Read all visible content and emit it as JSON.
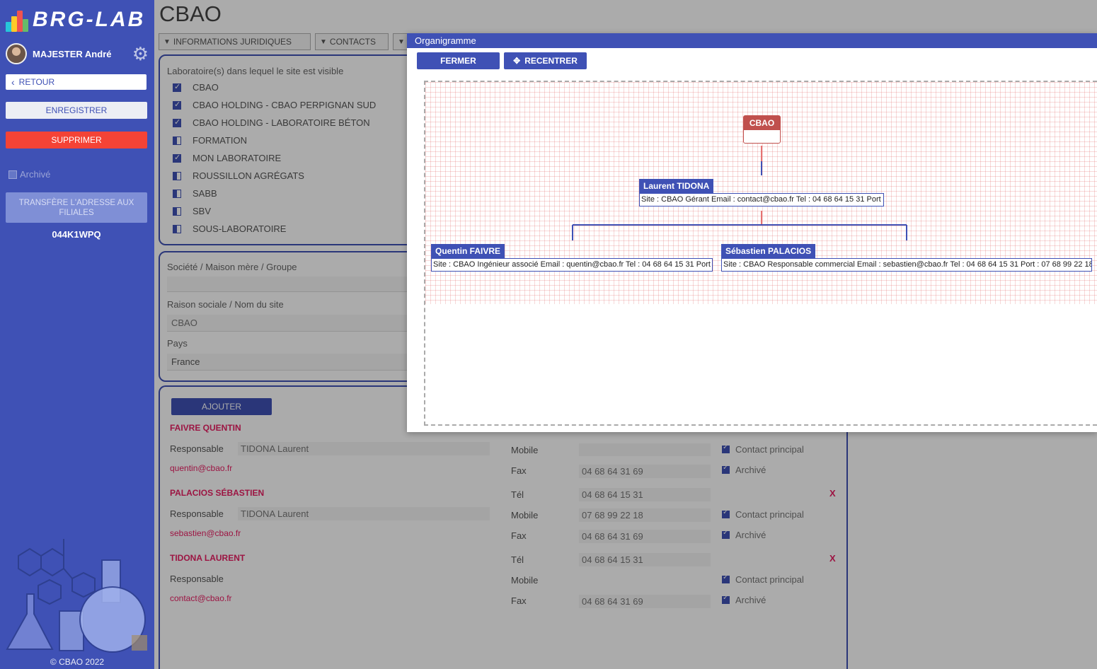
{
  "app": {
    "logo_text": "BRG-LAB",
    "copyright": "© CBAO 2022"
  },
  "user": {
    "name": "MAJESTER André"
  },
  "sidebar": {
    "back_label": "RETOUR",
    "save_label": "ENREGISTRER",
    "delete_label": "SUPPRIMER",
    "archived_label": "Archivé",
    "transfer_label": "TRANSFÈRE L'ADRESSE AUX FILIALES",
    "site_code": "044K1WPQ"
  },
  "page": {
    "title": "CBAO",
    "tabs": [
      {
        "label": "INFORMATIONS JURIDIQUES"
      },
      {
        "label": "CONTACTS"
      },
      {
        "label": ""
      }
    ]
  },
  "labs": {
    "label": "Laboratoire(s) dans lequel le site est visible",
    "items": [
      {
        "label": "CBAO",
        "checked": true
      },
      {
        "label": "CBAO HOLDING - CBAO PERPIGNAN SUD",
        "checked": true
      },
      {
        "label": "CBAO HOLDING - LABORATOIRE BÉTON",
        "checked": true
      },
      {
        "label": "FORMATION",
        "checked": false
      },
      {
        "label": "MON LABORATOIRE",
        "checked": true
      },
      {
        "label": "ROUSSILLON AGRÉGATS",
        "checked": false
      },
      {
        "label": "SABB",
        "checked": false
      },
      {
        "label": "SBV",
        "checked": false
      },
      {
        "label": "SOUS-LABORATOIRE",
        "checked": false
      }
    ]
  },
  "company": {
    "group_label": "Société / Maison mère / Groupe",
    "name_label": "Raison sociale / Nom du site",
    "name_value": "CBAO",
    "country_label": "Pays",
    "country_value": "France"
  },
  "contacts": {
    "add_label": "AJOUTER",
    "labels": {
      "responsible": "Responsable",
      "tel": "Tél",
      "mobile": "Mobile",
      "fax": "Fax",
      "main_contact": "Contact principal",
      "archived": "Archivé",
      "delete": "X"
    },
    "rows": [
      {
        "name": "FAIVRE QUENTIN",
        "responsible": "TIDONA Laurent",
        "email": "quentin@cbao.fr",
        "tel": "",
        "mobile": "",
        "fax": "04 68 64 31 69"
      },
      {
        "name": "PALACIOS SÉBASTIEN",
        "responsible": "TIDONA Laurent",
        "email": "sebastien@cbao.fr",
        "tel": "04 68 64 15 31",
        "mobile": "07 68 99 22 18",
        "fax": "04 68 64 31 69"
      },
      {
        "name": "TIDONA LAURENT",
        "responsible": "",
        "email": "contact@cbao.fr",
        "tel": "04 68 64 15 31",
        "mobile": "",
        "fax": "04 68 64 31 69"
      }
    ]
  },
  "modal": {
    "title": "Organigramme",
    "close_label": "FERMER",
    "center_label": "RECENTRER",
    "root": "CBAO",
    "nodes": [
      {
        "name": "Laurent TIDONA",
        "detail": "Site : CBAO Gérant Email : contact@cbao.fr Tel : 04 68 64 15 31 Port :"
      },
      {
        "name": "Quentin FAIVRE",
        "detail": "Site : CBAO Ingénieur associé Email : quentin@cbao.fr Tel : 04 68 64 15 31 Port :"
      },
      {
        "name": "Sébastien PALACIOS",
        "detail": "Site : CBAO Responsable commercial Email : sebastien@cbao.fr Tel : 04 68 64 15 31 Port : 07 68 99 22 18"
      }
    ]
  },
  "colors": {
    "primary": "#3f51b5",
    "danger": "#f44336",
    "accent": "#e91e63",
    "root_node": "#c0504d"
  }
}
